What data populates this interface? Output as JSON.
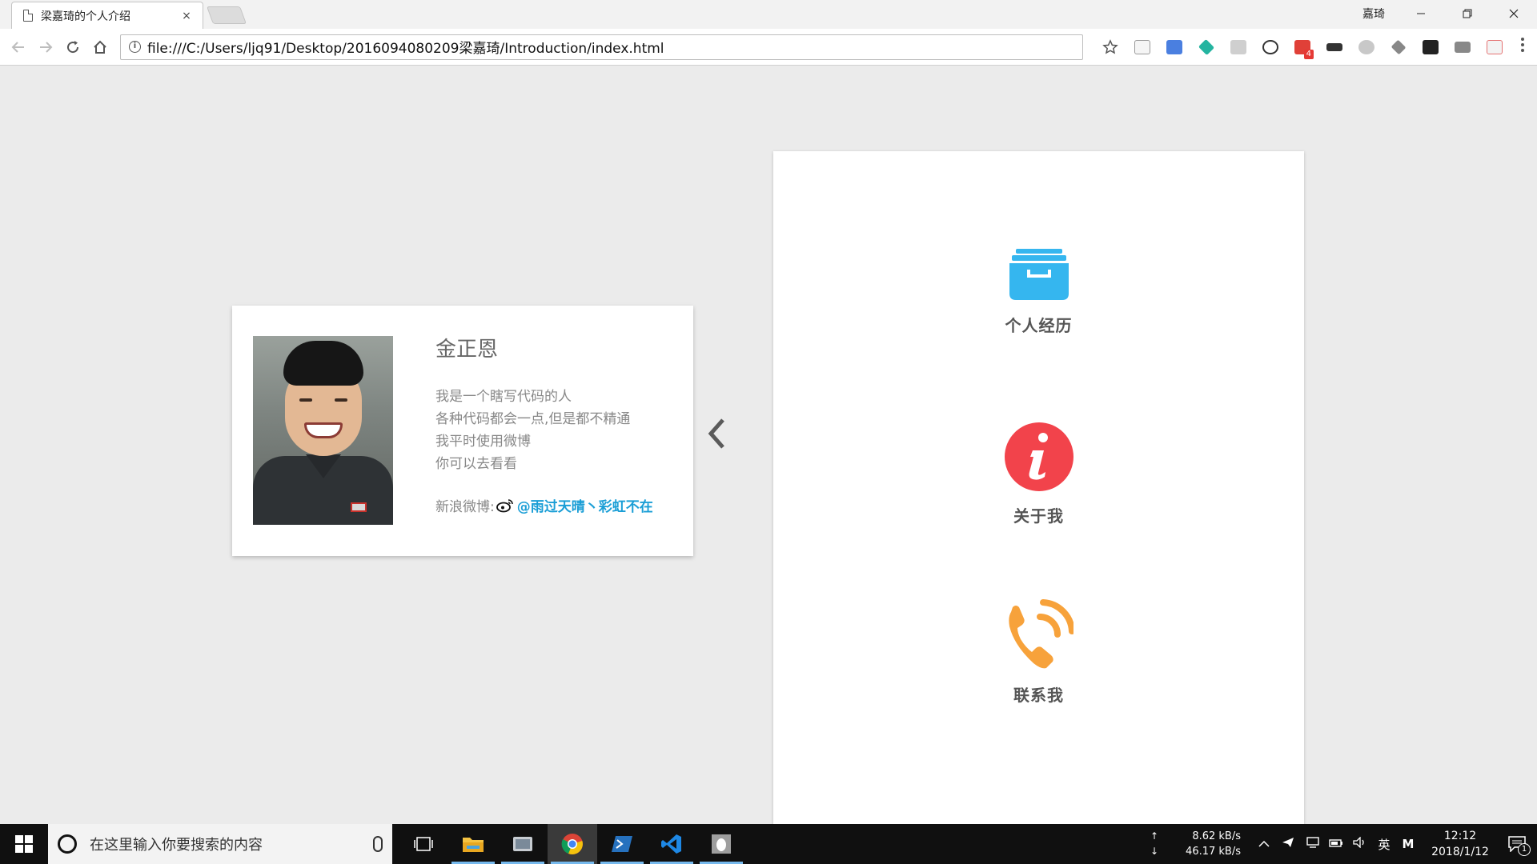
{
  "browser": {
    "tab_title": "梁嘉琦的个人介绍",
    "tab_close": "×",
    "profile_name": "嘉琦",
    "url": "file:///C:/Users/ljq91/Desktop/2016094080209梁嘉琦/Introduction/index.html",
    "info_icon_glyph": "i",
    "mail_badge": "4",
    "icons": {
      "back": "arrow-left-icon",
      "forward": "arrow-right-icon",
      "reload": "reload-icon",
      "home": "home-icon",
      "bookmark": "star-icon",
      "menu": "more-vertical-icon"
    }
  },
  "profile_card": {
    "name": "金正恩",
    "bio_lines": [
      "我是一个瞎写代码的人",
      "各种代码都会一点,但是都不精通",
      "我平时使用微博",
      "你可以去看看"
    ],
    "weibo_label": "新浪微博:",
    "weibo_handle": "@雨过天晴丶彩虹不在",
    "link_color": "#1a9ed6"
  },
  "side_panel": {
    "items": [
      {
        "label": "个人经历",
        "icon": "archive-box-icon",
        "color": "#35b6ef"
      },
      {
        "label": "关于我",
        "icon": "info-circle-icon",
        "color": "#f2434b"
      },
      {
        "label": "联系我",
        "icon": "phone-ringing-icon",
        "color": "#f7a23b"
      }
    ]
  },
  "taskbar": {
    "search_placeholder": "在这里输入你要搜索的内容",
    "upload_speed": "8.62 kB/s",
    "download_speed": "46.17 kB/s",
    "up_arrow": "↑",
    "down_arrow": "↓",
    "ime": "英",
    "ime_mode": "M",
    "time": "12:12",
    "date": "2018/1/12",
    "notification_count": "1",
    "apps": [
      "file-explorer-icon",
      "photo-viewer-icon",
      "chrome-icon",
      "powershell-icon",
      "vscode-icon",
      "qq-icon"
    ]
  }
}
